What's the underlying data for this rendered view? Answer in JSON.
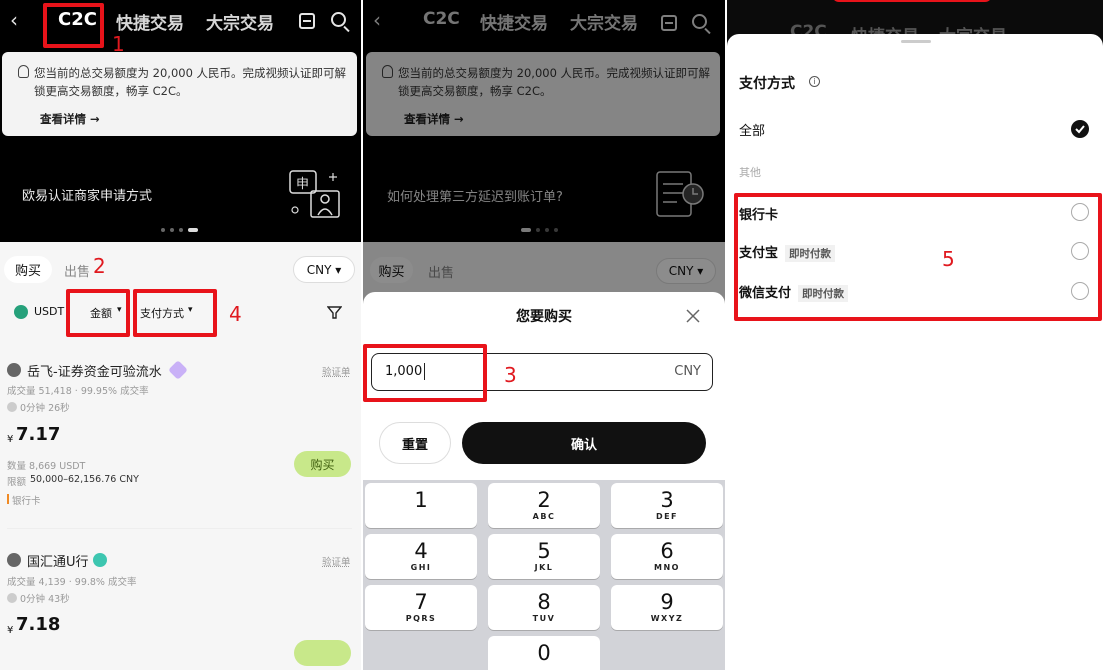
{
  "p1": {
    "tabs": [
      "C2C",
      "快捷交易",
      "大宗交易"
    ],
    "notice": {
      "text": "您当前的总交易额度为 20,000 人民币。完成视频认证即可解锁更高交易额度，畅享 C2C。",
      "more": "查看详情 →"
    },
    "banner": "欧易认证商家申请方式",
    "buy": "购买",
    "sell": "出售",
    "currency": "CNY ▾",
    "filters": {
      "coin": "USDT",
      "amount": "金额",
      "payment": "支付方式"
    },
    "listings": [
      {
        "name": "岳飞-证券资金可验流水",
        "badge": "验证单",
        "stats": "成交量 51,418 · 99.95% 成交率",
        "time": "0分钟 26秒",
        "currency_sign": "¥",
        "price": "7.17",
        "qty": "数量 8,669 USDT",
        "limit_label": "限额",
        "limit": "50,000–62,156.76 CNY",
        "method": "银行卡",
        "button": "购买"
      },
      {
        "name": "国汇通U行",
        "badge": "验证单",
        "stats": "成交量 4,139 · 99.8% 成交率",
        "time": "0分钟 43秒",
        "currency_sign": "¥",
        "price": "7.18"
      }
    ]
  },
  "p2": {
    "tabs": [
      "C2C",
      "快捷交易",
      "大宗交易"
    ],
    "notice": {
      "text": "您当前的总交易额度为 20,000 人民币。完成视频认证即可解锁更高交易额度，畅享 C2C。",
      "more": "查看详情 →"
    },
    "banner": "如何处理第三方延迟到账订单?",
    "buy": "购买",
    "sell": "出售",
    "currency": "CNY ▾",
    "sheet_title": "您要购买",
    "amount_value": "1,000",
    "amount_unit": "CNY",
    "reset": "重置",
    "confirm": "确认",
    "keys": [
      {
        "n": "1",
        "l": ""
      },
      {
        "n": "2",
        "l": "ABC"
      },
      {
        "n": "3",
        "l": "DEF"
      },
      {
        "n": "4",
        "l": "GHI"
      },
      {
        "n": "5",
        "l": "JKL"
      },
      {
        "n": "6",
        "l": "MNO"
      },
      {
        "n": "7",
        "l": "PQRS"
      },
      {
        "n": "8",
        "l": "TUV"
      },
      {
        "n": "9",
        "l": "WXYZ"
      },
      {
        "n": "",
        "l": ""
      },
      {
        "n": "0",
        "l": ""
      },
      {
        "n": "",
        "l": ""
      }
    ]
  },
  "p3": {
    "tabs": [
      "C2C",
      "快捷交易",
      "大宗交易"
    ],
    "title": "支付方式",
    "all": "全部",
    "other": "其他",
    "methods": [
      {
        "name": "银行卡",
        "tag": ""
      },
      {
        "name": "支付宝",
        "tag": "即时付款"
      },
      {
        "name": "微信支付",
        "tag": "即时付款"
      }
    ]
  },
  "annotations": [
    "1",
    "2",
    "3",
    "4",
    "5"
  ],
  "colors": {
    "annotation_red": "#e8131a",
    "buy_green": "#c8e88a",
    "check_black": "#111111"
  }
}
